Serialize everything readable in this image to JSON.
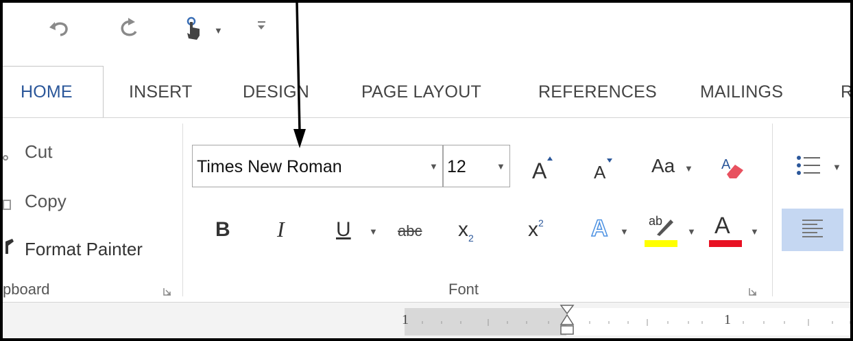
{
  "tabs": [
    "HOME",
    "INSERT",
    "DESIGN",
    "PAGE LAYOUT",
    "REFERENCES",
    "MAILINGS",
    "R"
  ],
  "clipboard": {
    "cut_label": "Cut",
    "copy_label": "Copy",
    "format_painter_label": "Format Painter",
    "group_label": "pboard"
  },
  "font": {
    "font_name": "Times New Roman",
    "font_size": "12",
    "group_label": "Font",
    "change_case_label": "Aa",
    "bold_label": "B",
    "italic_label": "I",
    "underline_label": "U",
    "strikethrough_label": "abc",
    "subscript_label": "x",
    "subscript_small": "2",
    "superscript_label": "x",
    "superscript_small": "2",
    "text_effects_label": "A",
    "highlight_label": "ab",
    "font_color_label": "A",
    "highlight_color": "#ffff00",
    "font_color": "#e81123"
  },
  "ruler": {
    "left_number": "1",
    "right_number": "1"
  },
  "colors": {
    "accent": "#2b579a",
    "selected_bg": "#c5d7f2"
  }
}
